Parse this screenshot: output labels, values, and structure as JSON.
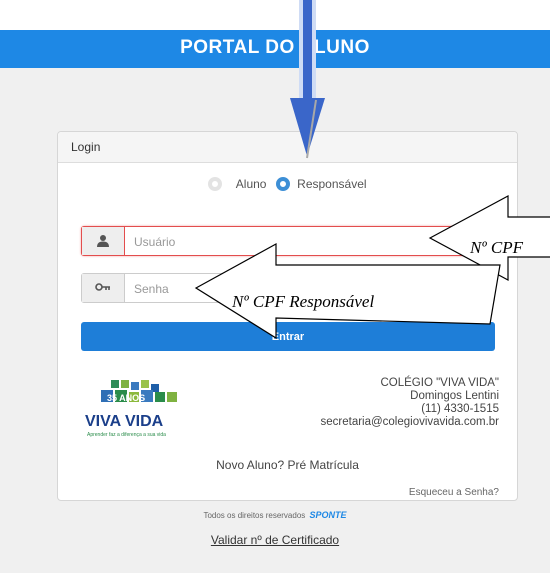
{
  "header": {
    "title": "PORTAL DO ALUNO"
  },
  "login": {
    "title": "Login",
    "radio_aluno": "Aluno",
    "radio_responsavel": "Responsável",
    "selected": "Responsável",
    "user_placeholder": "Usuário",
    "password_placeholder": "Senha",
    "submit_label": "Entrar"
  },
  "school": {
    "logo_banner": "35 ANOS",
    "logo_name": "VIVA VIDA",
    "logo_tagline": "Aprender faz a diferença a sua vida",
    "name": "COLÉGIO \"VIVA VIDA\"",
    "street": "Domingos Lentini",
    "phone": "(11) 4330-1515",
    "email": "secretaria@colegiovivavida.com.br"
  },
  "links": {
    "new_student": "Novo Aluno? Pré Matrícula",
    "forgot": "Esqueceu a Senha?",
    "rights": "Todos os direitos reservados",
    "brand": "SPONTE",
    "validate": "Validar nº de Certificado"
  },
  "annotations": {
    "top_right": "Nº CPF",
    "middle": "Nº CPF Responsável"
  },
  "colors": {
    "primary": "#1e88e5",
    "error": "#e34d4d",
    "arrow": "#3a66c9"
  },
  "icons": [
    "user-icon",
    "key-icon"
  ]
}
